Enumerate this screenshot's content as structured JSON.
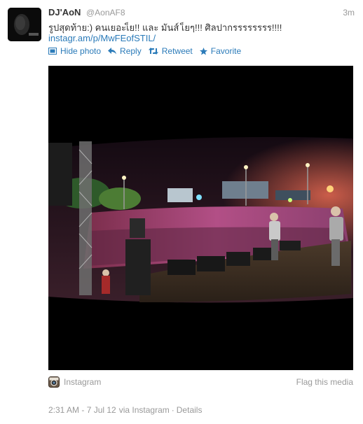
{
  "tweet": {
    "author_name": "DJ'AoN",
    "author_handle": "@AonAF8",
    "time_ago": "3m",
    "text": "รูปสุดท้าย:) คนเยอะเ็ย!! และ มันส์ เ็ยๆ!!! ศิลปากรรรรรรรร!!!!",
    "link": "instagr.am/p/MwFEofSTIL/"
  },
  "actions": {
    "hide_photo": "Hide photo",
    "reply": "Reply",
    "retweet": "Retweet",
    "favorite": "Favorite"
  },
  "media": {
    "source": "Instagram",
    "flag": "Flag this media"
  },
  "footer": {
    "timestamp": "2:31 AM - 7 Jul 12",
    "via": "via Instagram",
    "separator": "·",
    "details": "Details"
  },
  "colors": {
    "link": "#2b7bb9",
    "muted": "#999999",
    "text": "#333333"
  },
  "icons": {
    "hide_photo": "photo-icon",
    "reply": "reply-arrow-icon",
    "retweet": "retweet-icon",
    "favorite": "star-icon",
    "media_source": "instagram-icon"
  }
}
